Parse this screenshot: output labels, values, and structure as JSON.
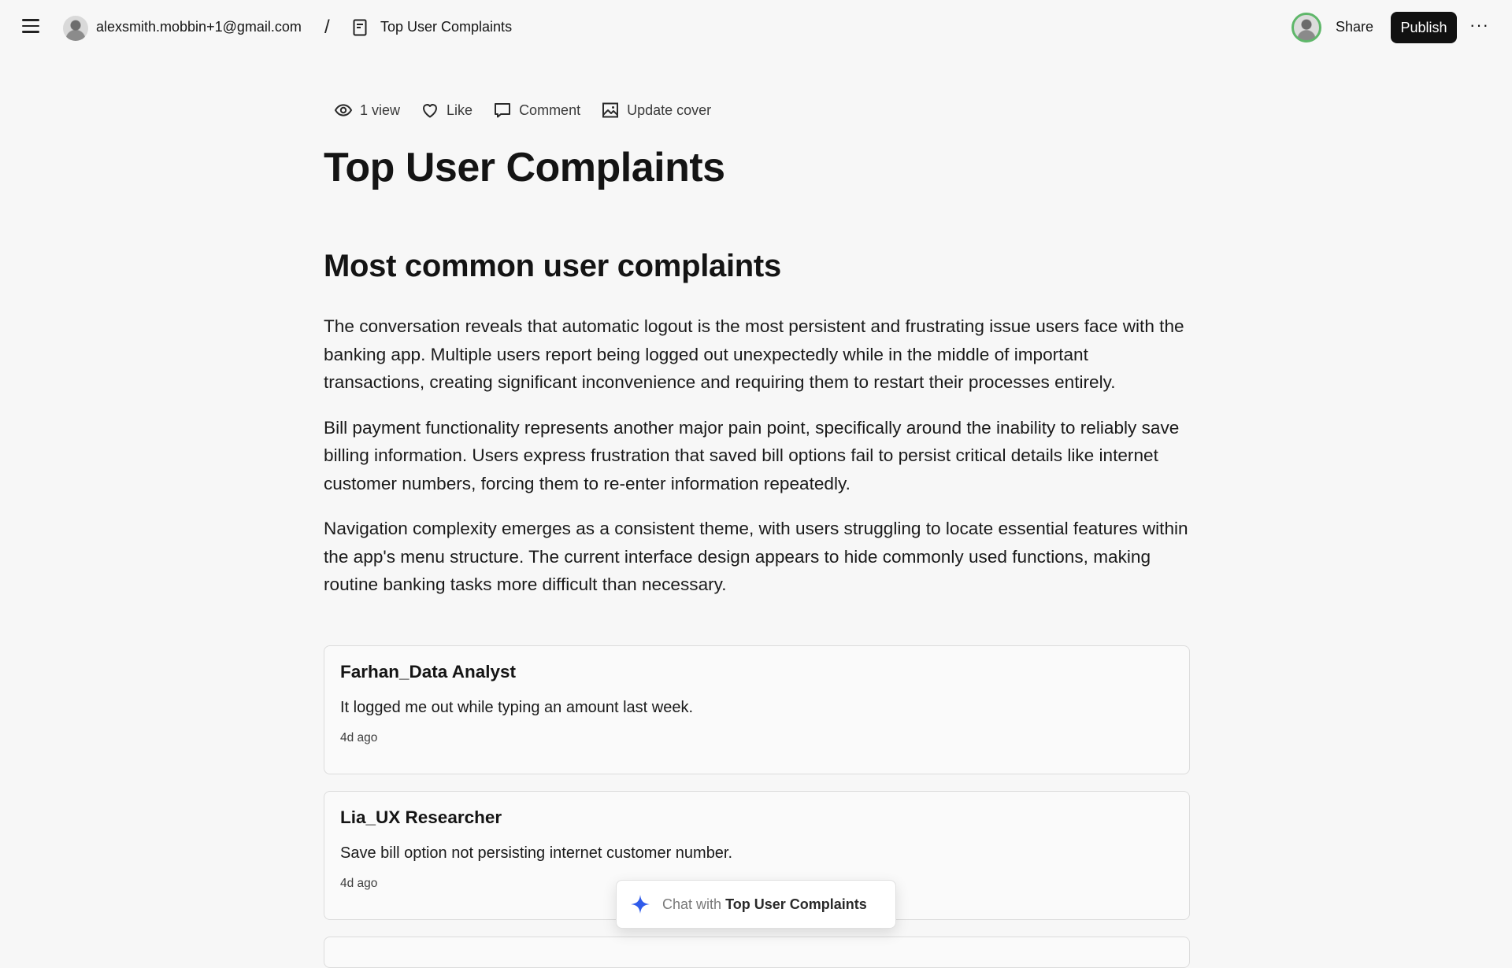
{
  "header": {
    "account_email": "alexsmith.mobbin+1@gmail.com",
    "breadcrumb_separator": "/",
    "doc_title": "Top User Complaints",
    "share_label": "Share",
    "publish_label": "Publish",
    "more_label": "···"
  },
  "meta": {
    "views": "1 view",
    "like": "Like",
    "comment": "Comment",
    "update_cover": "Update cover"
  },
  "doc": {
    "title": "Top User Complaints",
    "section_heading": "Most common user complaints",
    "paragraphs": [
      "The conversation reveals that automatic logout is the most persistent and frustrating issue users face with the banking app. Multiple users report being logged out unexpectedly while in the middle of important transactions, creating significant inconvenience and requiring them to restart their processes entirely.",
      "Bill payment functionality represents another major pain point, specifically around the inability to reliably save billing information. Users express frustration that saved bill options fail to persist critical details like internet customer numbers, forcing them to re-enter information repeatedly.",
      "Navigation complexity emerges as a consistent theme, with users struggling to locate essential features within the app's menu structure. The current interface design appears to hide commonly used functions, making routine banking tasks more difficult than necessary."
    ]
  },
  "comments": [
    {
      "author": "Farhan_Data Analyst",
      "text": "It logged me out while typing an amount last week.",
      "time": "4d ago"
    },
    {
      "author": "Lia_UX Researcher",
      "text": "Save bill option not persisting internet customer number.",
      "time": "4d ago"
    }
  ],
  "chat": {
    "prefix": "Chat with",
    "doc_name": "Top User Complaints",
    "icon": "sparkle-icon",
    "accent": "#2f5bea"
  },
  "colors": {
    "background": "#f7f7f7",
    "publish_bg": "#111111",
    "avatar_ring": "#5fb76a"
  }
}
